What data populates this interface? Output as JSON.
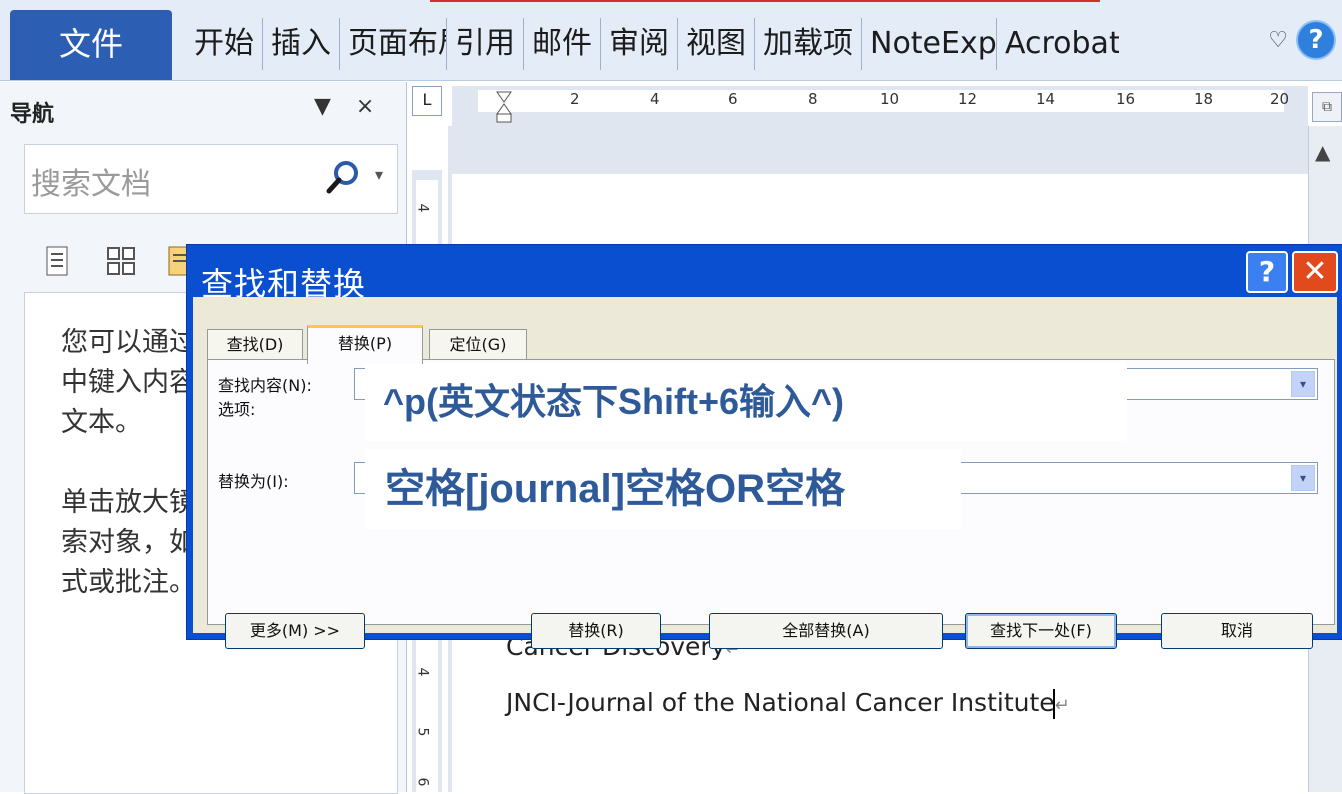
{
  "ribbon": {
    "file_tab": "文件",
    "tabs": [
      "开始",
      "插入",
      "页面布局",
      "引用",
      "邮件",
      "审阅",
      "视图",
      "加载项",
      "NoteExpress",
      "Acrobat"
    ],
    "minimize_icon": "chevron-down-icon",
    "help_label": "?"
  },
  "nav": {
    "title": "导航",
    "menu_glyph": "▼",
    "close_glyph": "×",
    "search_placeholder": "搜索文档",
    "dropdown_glyph": "▾",
    "body_para1": "您可以通过在上方的搜索框中键入内容来搜索文档中的文本。",
    "body_para2": "单击放大镜(查找命令)可搜索对象，如图形、表格、公式或批注。"
  },
  "ruler": {
    "corner": "L",
    "h_numbers": [
      "2",
      "4",
      "6",
      "8",
      "10",
      "12",
      "14",
      "16",
      "18",
      "20"
    ],
    "v_numbers": [
      "4",
      "4",
      "5",
      "6"
    ]
  },
  "document": {
    "lines": [
      "Cancer Discovery",
      "JNCI-Journal of the National Cancer Institute"
    ],
    "para_mark": "↵"
  },
  "dialog": {
    "title": "查找和替换",
    "help": "?",
    "close": "✕",
    "tabs": [
      "查找(D)",
      "替换(P)",
      "定位(G)"
    ],
    "active_tab": "替换(P)",
    "find_label": "查找内容(N):",
    "options_label": "选项:",
    "replace_label": "替换为(I):",
    "find_overlay": "^p(英文状态下Shift+6输入^)",
    "replace_overlay": "空格[journal]空格OR空格",
    "combo_arrow": "▾",
    "buttons": {
      "more": "更多(M) >>",
      "replace": "替换(R)",
      "replace_all": "全部替换(A)",
      "find_next": "查找下一处(F)",
      "cancel": "取消"
    }
  },
  "colors": {
    "file_tab": "#2c5fb3",
    "dialog_title_bar": "#0a4fd0",
    "close_button": "#e04a1c",
    "overlay_text": "#2e5a99"
  }
}
